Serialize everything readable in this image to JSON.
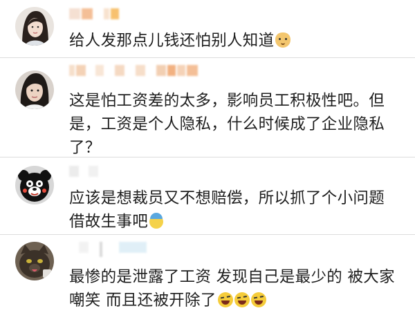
{
  "comments": [
    {
      "lines": [
        "给人发那点儿钱还怕别人知道"
      ],
      "emojis": [
        "doge-emoji"
      ]
    },
    {
      "lines": [
        "这是怕工资差的太多，影响员工积极性吧。但",
        "是，工资是个人隐私，什么时候成了企业隐私",
        "了？"
      ],
      "emojis": []
    },
    {
      "lines": [
        "应该是想裁员又不想赔偿，所以抓了个小问题",
        "借故生事吧"
      ],
      "emojis": [
        "umbrella-emoji"
      ]
    },
    {
      "lines": [
        "最惨的是泄露了工资 发现自己是最少的 被大家",
        "嘲笑 而且还被开除了"
      ],
      "emojis": [
        "laugh-cry-emoji",
        "laugh-cry-emoji",
        "laugh-cry-emoji"
      ]
    }
  ],
  "colors": {
    "divider": "#dcdcdc",
    "text": "#1e1e1e",
    "username_blur": "#f0a46a"
  }
}
